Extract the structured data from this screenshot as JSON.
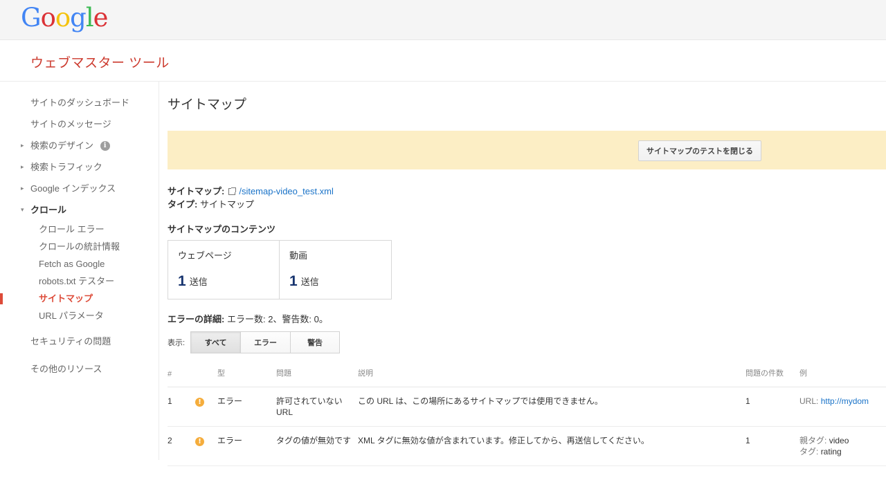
{
  "header": {
    "logo_letters": [
      {
        "char": "G",
        "color": "#4285f4"
      },
      {
        "char": "o",
        "color": "#db3236"
      },
      {
        "char": "o",
        "color": "#f4c20d"
      },
      {
        "char": "g",
        "color": "#4285f4"
      },
      {
        "char": "l",
        "color": "#3cba54"
      },
      {
        "char": "e",
        "color": "#db3236"
      }
    ],
    "product_title": "ウェブマスター ツール"
  },
  "sidebar": {
    "items": [
      {
        "label": "サイトのダッシュボード",
        "type": "link"
      },
      {
        "label": "サイトのメッセージ",
        "type": "link"
      },
      {
        "label": "検索のデザイン",
        "type": "group",
        "arrow": "▸",
        "has_info_icon": true
      },
      {
        "label": "検索トラフィック",
        "type": "group",
        "arrow": "▸"
      },
      {
        "label": "Google インデックス",
        "type": "group",
        "arrow": "▸"
      },
      {
        "label": "クロール",
        "type": "group-expanded",
        "arrow": "▾"
      },
      {
        "label": "クロール エラー",
        "type": "child"
      },
      {
        "label": "クロールの統計情報",
        "type": "child"
      },
      {
        "label": "Fetch as Google",
        "type": "child"
      },
      {
        "label": "robots.txt テスター",
        "type": "child"
      },
      {
        "label": "サイトマップ",
        "type": "child-active"
      },
      {
        "label": "URL パラメータ",
        "type": "child"
      },
      {
        "label": "セキュリティの問題",
        "type": "link"
      },
      {
        "label": "その他のリソース",
        "type": "link"
      }
    ],
    "active_color": "#dd4b39"
  },
  "main": {
    "page_title": "サイトマップ",
    "banner": {
      "close_test_button": "サイトマップのテストを閉じる",
      "background_color": "#fceec5"
    },
    "meta": {
      "sitemap_label": "サイトマップ:",
      "sitemap_url": "/sitemap-video_test.xml",
      "type_label": "タイプ:",
      "type_value": "サイトマップ"
    },
    "contents": {
      "title": "サイトマップのコンテンツ",
      "cards": [
        {
          "label": "ウェブページ",
          "number": "1",
          "unit": "送信"
        },
        {
          "label": "動画",
          "number": "1",
          "unit": "送信"
        }
      ]
    },
    "errors": {
      "heading_label": "エラーの詳細:",
      "heading_text": "エラー数: 2、警告数: 0。",
      "filter_label": "表示:",
      "filters": [
        {
          "label": "すべて",
          "selected": true
        },
        {
          "label": "エラー",
          "selected": false
        },
        {
          "label": "警告",
          "selected": false
        }
      ]
    },
    "table": {
      "columns": [
        "#",
        "",
        "型",
        "問題",
        "説明",
        "問題の件数",
        "例"
      ],
      "rows": [
        {
          "num": "1",
          "icon": "warning-icon",
          "type": "エラー",
          "issue": "許可されていない URL",
          "description": "この URL は、この場所にあるサイトマップでは使用できません。",
          "count": "1",
          "example_label": "URL:",
          "example_value": "http://mydom",
          "example_line2_label": "",
          "example_line2_value": ""
        },
        {
          "num": "2",
          "icon": "warning-icon",
          "type": "エラー",
          "issue": "タグの値が無効です",
          "description": "XML タグに無効な値が含まれています。修正してから、再送信してください。",
          "count": "1",
          "example_label": "親タグ:",
          "example_value": "video",
          "example_line2_label": "タグ:",
          "example_line2_value": "rating"
        }
      ]
    }
  }
}
